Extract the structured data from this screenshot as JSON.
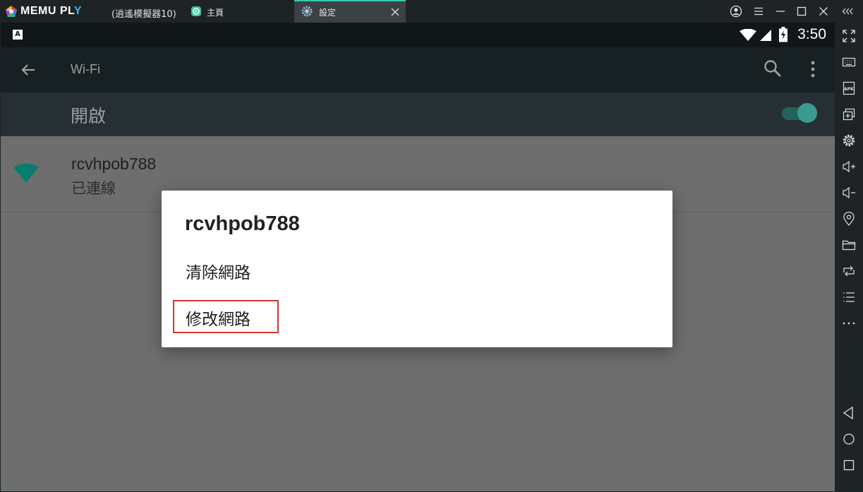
{
  "titlebar": {
    "brand": "MEMU PL",
    "brand_tail": "Y",
    "instance": "(逍遙模擬器10)",
    "tabs": [
      {
        "label": "主頁",
        "icon": "memu-home-icon"
      },
      {
        "label": "設定",
        "icon": "settings-gear-icon",
        "active": true
      }
    ],
    "controls": [
      "account-icon",
      "menu-icon",
      "minimize-icon",
      "maximize-icon",
      "close-icon",
      "collapse-sidebar-icon"
    ]
  },
  "statusbar": {
    "keyboard_indicator": "A",
    "time": "3:50",
    "icons": [
      "wifi-full-icon",
      "cell-signal-icon",
      "battery-charging-icon"
    ]
  },
  "appbar": {
    "title": "Wi-Fi",
    "icons": [
      "back-arrow-icon",
      "search-icon",
      "overflow-menu-icon"
    ]
  },
  "wifi_switch": {
    "label": "開啟",
    "on": true
  },
  "network_list": [
    {
      "ssid": "rcvhpob788",
      "status": "已連線",
      "signal_level": 4
    }
  ],
  "dialog": {
    "title": "rcvhpob788",
    "options": [
      "清除網路",
      "修改網路"
    ],
    "highlighted_option": 1
  },
  "toolbar": {
    "icons": [
      "fullscreen-icon",
      "keyboard-icon",
      "apk-icon",
      "multi-window-icon",
      "settings-icon",
      "volume-up-icon",
      "volume-down-icon",
      "location-icon",
      "folder-icon",
      "rotate-icon",
      "list-icon",
      "more-icon",
      "back-nav-icon",
      "home-nav-icon",
      "recents-nav-icon"
    ]
  },
  "colors": {
    "accent": "#38c9b0",
    "switch_on": "#3a9c90",
    "highlight_box": "#d9342b",
    "wifi_icon": "#087d6e"
  }
}
